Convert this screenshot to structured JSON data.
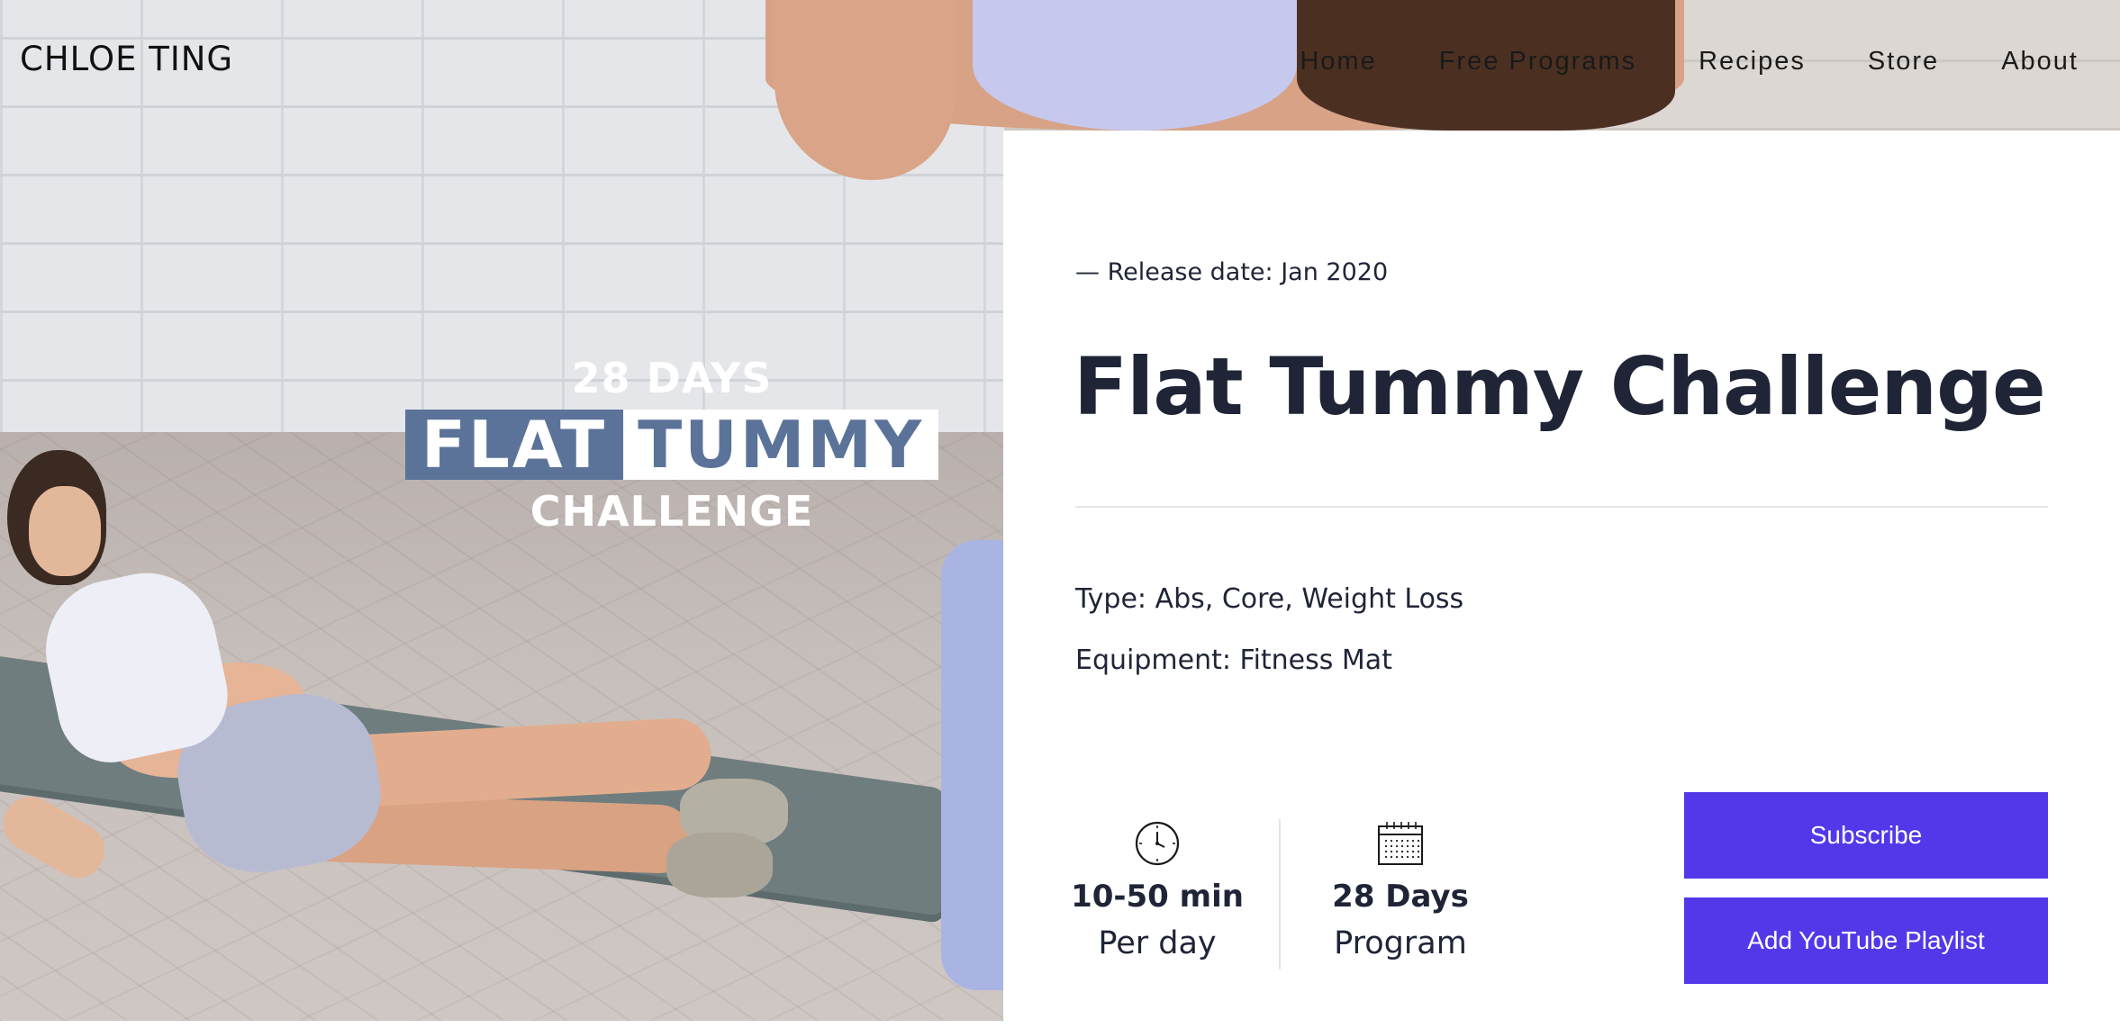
{
  "header": {
    "logo": "CHLOE TING",
    "nav": [
      "Home",
      "Free Programs",
      "Recipes",
      "Store",
      "About"
    ]
  },
  "hero_overlay": {
    "line1": "28 DAYS",
    "flat": "FLAT",
    "tummy": "TUMMY",
    "line3": "CHALLENGE"
  },
  "program": {
    "release": "— Release date: Jan 2020",
    "title": "Flat Tummy Challenge",
    "type": "Type: Abs, Core, Weight Loss",
    "equipment": "Equipment: Fitness Mat"
  },
  "stats": [
    {
      "icon": "clock-icon",
      "value": "10-50 min",
      "label": "Per day"
    },
    {
      "icon": "calendar-icon",
      "value": "28 Days",
      "label": "Program"
    }
  ],
  "buttons": {
    "subscribe": "Subscribe",
    "playlist": "Add YouTube Playlist"
  },
  "colors": {
    "accent": "#5139e9",
    "text_dark": "#1f2537",
    "promo_blue": "#5c7399"
  }
}
